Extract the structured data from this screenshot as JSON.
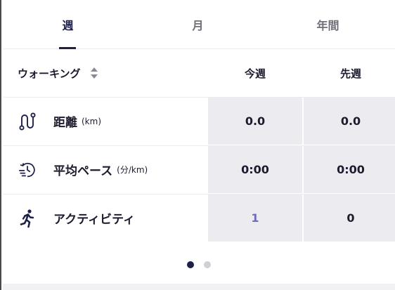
{
  "tabs": [
    {
      "label": "週",
      "active": true
    },
    {
      "label": "月",
      "active": false
    },
    {
      "label": "年間",
      "active": false
    }
  ],
  "sport_selector": {
    "label": "ウォーキング"
  },
  "columns": {
    "this_week": "今週",
    "last_week": "先週"
  },
  "rows": [
    {
      "icon": "route-icon",
      "name": "距離",
      "unit": "(km)",
      "this_week": "0.0",
      "last_week": "0.0"
    },
    {
      "icon": "clock-pace-icon",
      "name": "平均ペース",
      "unit": "(分/km)",
      "this_week": "0:00",
      "last_week": "0:00"
    },
    {
      "icon": "running-person-icon",
      "name": "アクティビティ",
      "unit": "",
      "this_week": "1",
      "last_week": "0"
    }
  ],
  "pagination": {
    "pages": 2,
    "current": 1
  },
  "colors": {
    "accent": "#1d2147",
    "link": "#6a6eb8",
    "cell_bg": "#ececf0"
  }
}
